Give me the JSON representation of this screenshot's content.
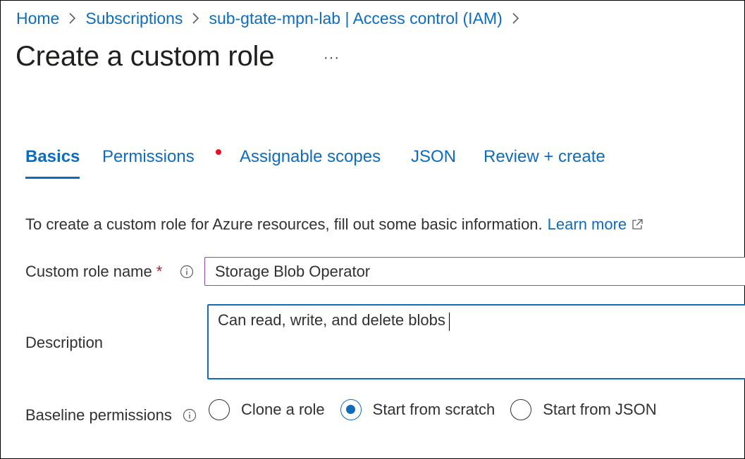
{
  "breadcrumb": {
    "items": [
      "Home",
      "Subscriptions",
      "sub-gtate-mpn-lab | Access control (IAM)"
    ]
  },
  "page": {
    "title": "Create a custom role",
    "more_label": "···"
  },
  "tabs": [
    {
      "label": "Basics",
      "active": true
    },
    {
      "label": "Permissions",
      "has_indicator": true
    },
    {
      "label": "Assignable scopes"
    },
    {
      "label": "JSON"
    },
    {
      "label": "Review + create"
    }
  ],
  "intro": {
    "text": "To create a custom role for Azure resources, fill out some basic information.",
    "link": "Learn more"
  },
  "form": {
    "role_name": {
      "label": "Custom role name",
      "required_mark": "*",
      "value": "Storage Blob Operator"
    },
    "description": {
      "label": "Description",
      "value": "Can read, write, and delete blobs"
    },
    "baseline": {
      "label": "Baseline permissions",
      "options": [
        "Clone a role",
        "Start from scratch",
        "Start from JSON"
      ],
      "selected": "Start from scratch"
    }
  },
  "colors": {
    "accent": "#0f6cbd",
    "required": "#a4262c",
    "indicator": "#e81123"
  }
}
